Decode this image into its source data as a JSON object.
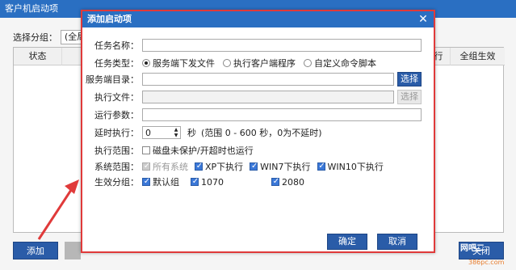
{
  "background": {
    "title": "客户机启动项",
    "group_label": "选择分组：",
    "group_value": "(全局设",
    "col_status": "状态",
    "col_exec": "执行",
    "col_scope": "全组生效",
    "add_label": "添加",
    "close_label": "关闭"
  },
  "dialog": {
    "title": "添加启动项",
    "task_name_label": "任务名称：",
    "task_name_value": "",
    "task_type_label": "任务类型：",
    "task_type_options": [
      "服务端下发文件",
      "执行客户端程序",
      "自定义命令脚本"
    ],
    "task_type_selected": 0,
    "server_dir_label": "服务端目录：",
    "server_dir_value": "",
    "select_label": "选择",
    "exec_file_label": "执行文件：",
    "exec_file_value": "",
    "run_params_label": "运行参数：",
    "run_params_value": "",
    "delay_label": "延时执行：",
    "delay_value": "0",
    "delay_unit": "秒",
    "delay_hint": "(范围 0 - 600 秒，0为不延时)",
    "exec_scope_label": "执行范围：",
    "exec_scope_option": "磁盘未保护/开超时也运行",
    "sys_scope_label": "系统范围：",
    "sys_scope_options": [
      {
        "label": "所有系统",
        "checked": true,
        "disabled": true
      },
      {
        "label": "XP下执行",
        "checked": true,
        "disabled": false
      },
      {
        "label": "WIN7下执行",
        "checked": true,
        "disabled": false
      },
      {
        "label": "WIN10下执行",
        "checked": true,
        "disabled": false
      }
    ],
    "group_label": "生效分组：",
    "group_options": [
      {
        "label": "默认组",
        "checked": true
      },
      {
        "label": "1070",
        "checked": true
      },
      {
        "label": "2080",
        "checked": true
      }
    ],
    "ok_label": "确定",
    "cancel_label": "取消"
  },
  "watermark": {
    "text": "网吧二",
    "sub": "386pc.com"
  },
  "colors": {
    "titlebar": "#2a6fc2",
    "button": "#2a5ca8",
    "highlight_border": "#e03a3a",
    "arrow": "#e03a3a"
  }
}
